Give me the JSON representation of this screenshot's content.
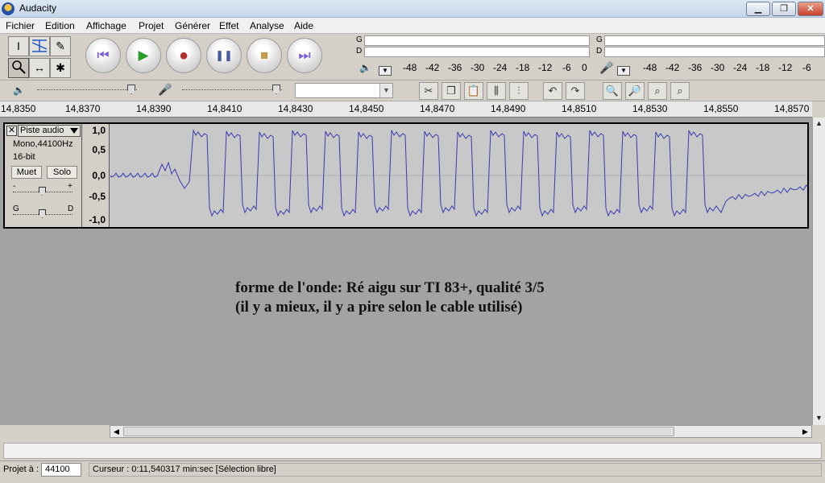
{
  "window": {
    "title": "Audacity",
    "min_icon": "minimize-icon",
    "max_icon": "restore-icon",
    "close_icon": "close-icon"
  },
  "menu": [
    "Fichier",
    "Edition",
    "Affichage",
    "Projet",
    "Générer",
    "Effet",
    "Analyse",
    "Aide"
  ],
  "tools": {
    "selection": "I",
    "multi": "✱",
    "zoom": "zoom-icon",
    "timeshift": "↔",
    "draw": "pencil-icon",
    "envelope": "envelope-icon"
  },
  "transport": {
    "skip_start": "⏮",
    "play": "▶",
    "record": "●",
    "pause": "❚❚",
    "stop": "■",
    "skip_end": "⏭"
  },
  "meters": {
    "play_ch": [
      "G",
      "D"
    ],
    "rec_ch": [
      "G",
      "D"
    ],
    "play_scale": [
      "-48",
      "-42",
      "-36",
      "-30",
      "-24",
      "-18",
      "-12",
      "-6",
      "0"
    ],
    "rec_scale": [
      "-48",
      "-42",
      "-36",
      "-30",
      "-24",
      "-18",
      "-12",
      "-6"
    ]
  },
  "ruler": [
    "14,8350",
    "14,8370",
    "14,8390",
    "14,8410",
    "14,8430",
    "14,8450",
    "14,8470",
    "14,8490",
    "14,8510",
    "14,8530",
    "14,8550",
    "14,8570"
  ],
  "track": {
    "close": "✕",
    "name": "Piste audio",
    "format": "Mono,44100Hz",
    "bits": "16-bit",
    "mute": "Muet",
    "solo": "Solo",
    "gain_minus": "-",
    "gain_plus": "+",
    "pan_left": "G",
    "pan_right": "D",
    "scale": [
      "1,0",
      "0,5",
      "0,0",
      "-0,5",
      "-1,0"
    ]
  },
  "note": {
    "line1": "forme de l'onde:  Ré aigu sur TI 83+, qualité 3/5",
    "line2": "(il y a mieux, il y a pire selon le cable utilisé)"
  },
  "status": {
    "project_rate_label": "Projet à :",
    "project_rate": "44100",
    "cursor": "Curseur : 0:11,540317 min:sec   [Sélection libre]"
  },
  "colors": {
    "waveform": "#3a3ab0",
    "track_bg": "#c8c8c8",
    "area_bg": "#a3a3a3"
  }
}
